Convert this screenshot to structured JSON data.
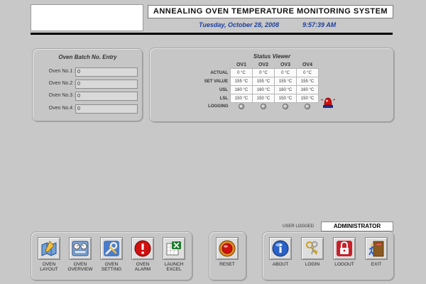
{
  "header": {
    "title": "ANNEALING OVEN TEMPERATURE MONITORING SYSTEM",
    "date": "Tuesday, October 28, 2008",
    "time": "9:57:39 AM"
  },
  "batch_entry": {
    "title": "Oven Batch No. Entry",
    "rows": [
      {
        "label": "Oven No.1 :",
        "value": "0"
      },
      {
        "label": "Oven No.2 :",
        "value": "0"
      },
      {
        "label": "Oven No.3 :",
        "value": "0"
      },
      {
        "label": "Oven No.4 :",
        "value": "0"
      }
    ]
  },
  "status_viewer": {
    "title": "Status Viewer",
    "columns": [
      "OV1",
      "OV2",
      "OV3",
      "OV4"
    ],
    "rows": [
      {
        "label": "ACTUAL",
        "values": [
          "0 °C",
          "0 °C",
          "0 °C",
          "0 °C"
        ]
      },
      {
        "label": "SET VALUE",
        "values": [
          "155 °C",
          "155 °C",
          "155 °C",
          "155 °C"
        ]
      },
      {
        "label": "USL",
        "values": [
          "160 °C",
          "160 °C",
          "160 °C",
          "160 °C"
        ]
      },
      {
        "label": "LSL",
        "values": [
          "150 °C",
          "150 °C",
          "150 °C",
          "150 °C"
        ]
      }
    ],
    "logging_label": "LOGGING"
  },
  "user": {
    "label": "USER LOGGED",
    "value": "ADMINISTRATOR"
  },
  "buttons": {
    "oven_layout": {
      "line1": "OVEN",
      "line2": "LAYOUT"
    },
    "oven_overview": {
      "line1": "OVEN",
      "line2": "OVERVIEW"
    },
    "oven_setting": {
      "line1": "OVEN",
      "line2": "SETTING"
    },
    "oven_alarm": {
      "line1": "OVEN",
      "line2": "ALARM"
    },
    "launch_excel": {
      "line1": "LAUNCH",
      "line2": "EXCEL"
    },
    "reset": {
      "line1": "RESET"
    },
    "about": {
      "line1": "ABOUT"
    },
    "login": {
      "line1": "LOGIN"
    },
    "logout": {
      "line1": "LOGOUT"
    },
    "exit": {
      "line1": "EXIT",
      "door_text": "EXIT"
    }
  },
  "colors": {
    "background": "#c8c8c8",
    "datetime": "#1c3fa0",
    "alarm_red": "#d01010"
  }
}
